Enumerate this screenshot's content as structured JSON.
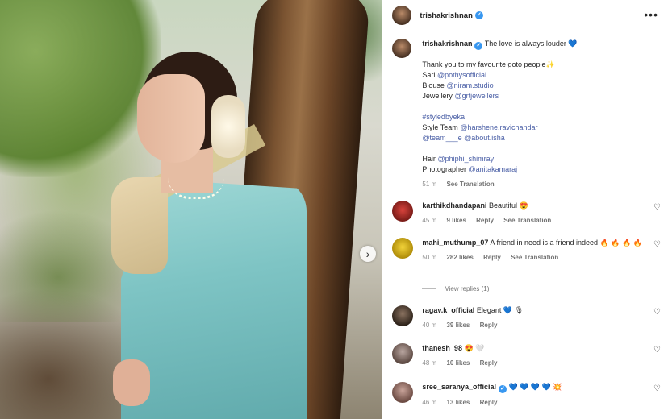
{
  "post": {
    "username": "trishakrishnan",
    "caption": {
      "username": "trishakrishnan",
      "line1": "The love is always louder",
      "emoji1": "💙",
      "thanks": "Thank you to my favourite goto people",
      "emoji2": "✨",
      "sari_label": "Sari",
      "sari_tag": "@pothysofficial",
      "blouse_label": "Blouse",
      "blouse_tag": "@niram.studio",
      "jewellery_label": "Jewellery",
      "jewellery_tag": "@grtjewellers",
      "hashtag": "#styledbyeka",
      "style_label": "Style Team",
      "style_tag1": "@harshene.ravichandar",
      "style_tag2": "@team___e",
      "style_tag3": "@about.isha",
      "hair_label": "Hair",
      "hair_tag": "@phiphi_shimray",
      "photo_label": "Photographer",
      "photo_tag": "@anitakamaraj",
      "time": "51 m",
      "see_translation": "See Translation"
    }
  },
  "comments": [
    {
      "user": "karthikdhandapani",
      "text": "Beautiful",
      "emoji": "😍",
      "time": "45 m",
      "likes": "9 likes",
      "reply": "Reply",
      "translation": "See Translation"
    },
    {
      "user": "mahi_muthump_07",
      "text": "A friend in need is a friend indeed",
      "emoji": "🔥 🔥 🔥 🔥",
      "time": "50 m",
      "likes": "282 likes",
      "reply": "Reply",
      "translation": "See Translation",
      "view_replies": "View replies (1)"
    },
    {
      "user": "ragav.k_official",
      "text": "Elegant",
      "emoji": "💙 🎙",
      "time": "40 m",
      "likes": "39 likes",
      "reply": "Reply"
    },
    {
      "user": "thanesh_98",
      "text": "",
      "emoji": "😍 🤍",
      "time": "48 m",
      "likes": "10 likes",
      "reply": "Reply"
    },
    {
      "user": "sree_saranya_official",
      "text": "",
      "emoji": "💙 💙 💙 💙 💥",
      "time": "46 m",
      "likes": "13 likes",
      "reply": "Reply"
    }
  ],
  "icons": {
    "verified": "✓",
    "more": "•••",
    "heart": "♡",
    "next": "›"
  },
  "colors": {
    "link": "#4a5fa6",
    "verified": "#3897f0"
  }
}
